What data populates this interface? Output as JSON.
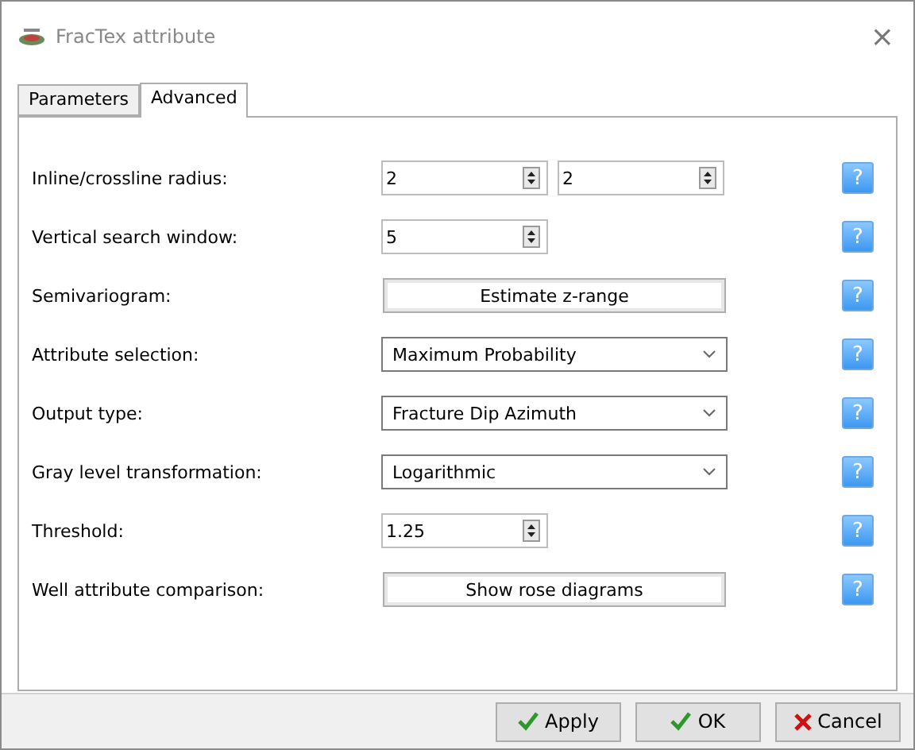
{
  "window": {
    "title": "FracTex attribute",
    "close": "×"
  },
  "tabs": [
    {
      "label": "Parameters",
      "selected": false
    },
    {
      "label": "Advanced",
      "selected": true
    }
  ],
  "rows": [
    {
      "label": "Inline/crossline radius:",
      "kind": "spinpair",
      "values": [
        "2",
        "2"
      ]
    },
    {
      "label": "Vertical search window:",
      "kind": "spin",
      "value": "5"
    },
    {
      "label": "Semivariogram:",
      "kind": "button",
      "text": "Estimate z-range"
    },
    {
      "label": "Attribute selection:",
      "kind": "combo",
      "value": "Maximum Probability"
    },
    {
      "label": "Output type:",
      "kind": "combo",
      "value": "Fracture Dip Azimuth"
    },
    {
      "label": "Gray level transformation:",
      "kind": "combo",
      "value": "Logarithmic"
    },
    {
      "label": "Threshold:",
      "kind": "spin",
      "value": "1.25"
    },
    {
      "label": "Well attribute comparison:",
      "kind": "button",
      "text": "Show rose diagrams"
    }
  ],
  "help_text": "?",
  "buttons": [
    {
      "label": "Apply",
      "kind": "check"
    },
    {
      "label": "OK",
      "kind": "check"
    },
    {
      "label": "Cancel",
      "kind": "cross"
    }
  ]
}
